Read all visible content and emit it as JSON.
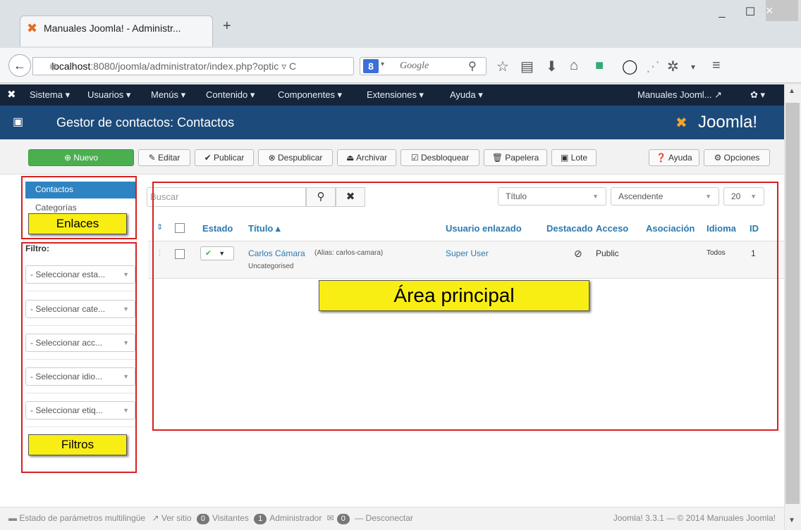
{
  "browser": {
    "tab_title": "Manuales Joomla! - Administr...",
    "new_tab": "+",
    "url_host": "localhost",
    "url_rest": ":8080/joomla/administrator/index.php?optic ▿ C",
    "search_placeholder": "Google",
    "search_engine_badge": "8",
    "win_minimize": "_",
    "win_maximize": "☐",
    "win_close": "×",
    "menu_glyph": "≡"
  },
  "menu": {
    "items": [
      "Sistema ▾",
      "Usuarios ▾",
      "Menús ▾",
      "Contenido ▾",
      "Componentes ▾",
      "Extensiones ▾",
      "Ayuda ▾"
    ],
    "site_link": "Manuales Jooml... ↗",
    "settings": "✿ ▾"
  },
  "header": {
    "title": "Gestor de contactos: Contactos",
    "logo_text": "Joomla!"
  },
  "toolbar": {
    "new": "⊕ Nuevo",
    "edit": "✎ Editar",
    "publish": "✔ Publicar",
    "unpublish": "⊗ Despublicar",
    "archive": "⏏ Archivar",
    "unlock": "☑ Desbloquear",
    "trash": "🗑 Papelera",
    "batch": "▣ Lote",
    "help": "❓ Ayuda",
    "options": "⚙ Opciones"
  },
  "sidebar": {
    "links": [
      "Contactos",
      "Categorías"
    ],
    "filter_label": "Filtro:",
    "filters": [
      "- Seleccionar esta...",
      "- Seleccionar cate...",
      "- Seleccionar acc...",
      "- Seleccionar idio...",
      "- Seleccionar etiq..."
    ]
  },
  "list": {
    "search_placeholder": "Buscar",
    "sort_field": "Título",
    "sort_dir": "Ascendente",
    "limit": "20",
    "columns": [
      "Estado",
      "Título ▴",
      "Usuario enlazado",
      "Destacado",
      "Acceso",
      "Asociación",
      "Idioma",
      "ID"
    ],
    "rows": [
      {
        "title": "Carlos Cámara",
        "alias": "(Alias: carlos-camara)",
        "category": "Uncategorised",
        "user": "Super User",
        "featured": "⊘",
        "access": "Public",
        "language": "Todos",
        "id": "1"
      }
    ]
  },
  "annotations": {
    "links": "Enlaces",
    "filters": "Filtros",
    "main": "Área principal"
  },
  "footer": {
    "multilang": "Estado de parámetros multilingüe",
    "view_site": "Ver sitio",
    "visitors_count": "0",
    "visitors": "Visitantes",
    "admin_count": "1",
    "admin": "Administrador",
    "msg_count": "0",
    "logout": "Desconectar",
    "version": "Joomla! 3.3.1 — © 2014 Manuales Joomla!"
  },
  "colors": {
    "menubar": "#16243a",
    "header": "#1c4a7a",
    "new_button": "#4bae4f",
    "link": "#2a7ab0",
    "annotation_box": "#d62020",
    "annotation_label": "#f9ee14"
  }
}
